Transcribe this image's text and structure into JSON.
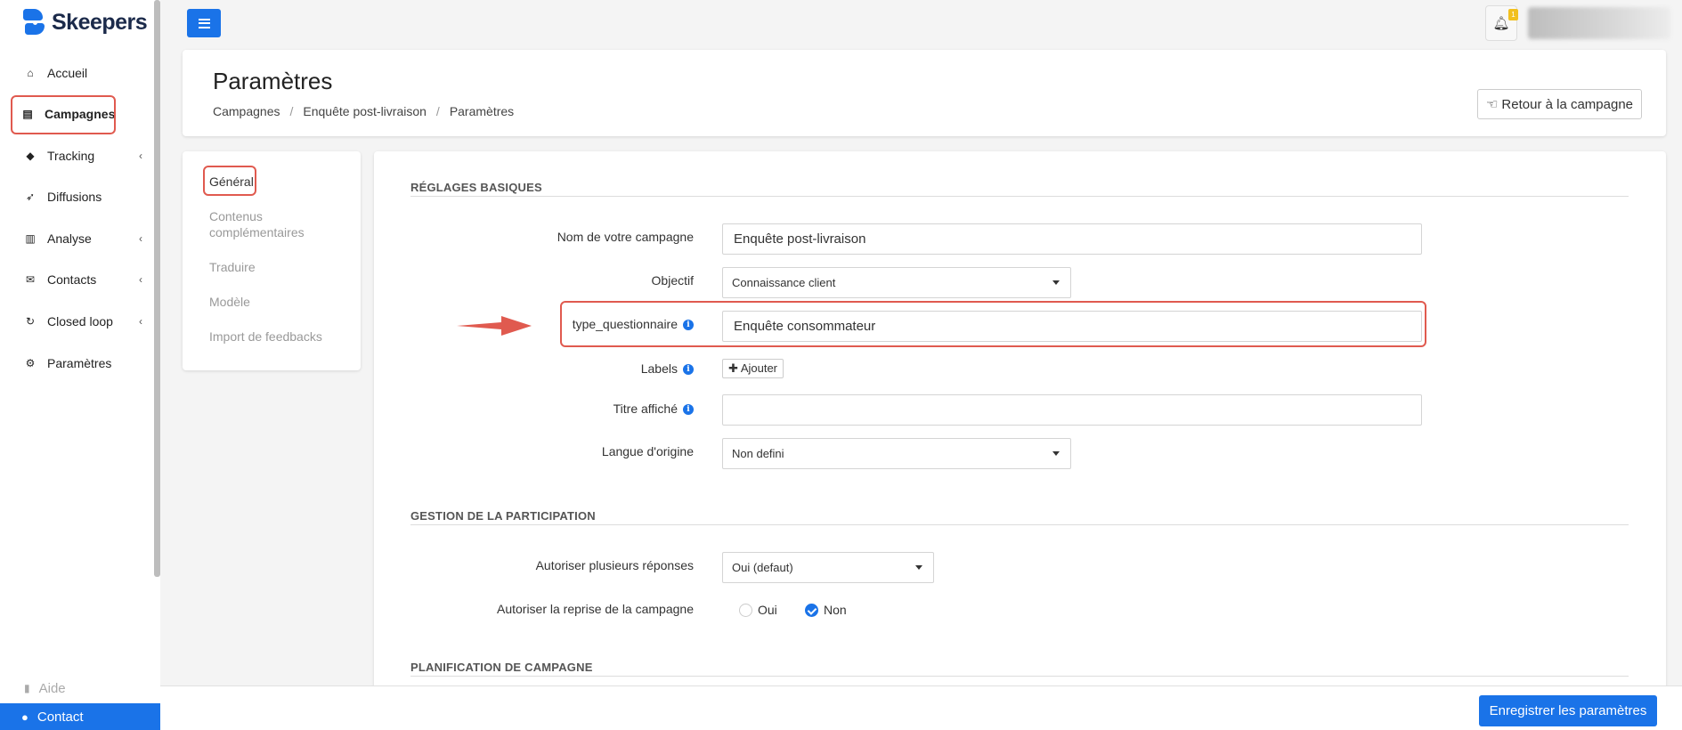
{
  "brand": {
    "name": "Skeepers",
    "accent": "#1a73e8",
    "highlight": "#e05a4f"
  },
  "sidebar": {
    "items": [
      {
        "label": "Accueil",
        "icon": "home-icon"
      },
      {
        "label": "Campagnes",
        "icon": "document-icon",
        "active": true
      },
      {
        "label": "Tracking",
        "icon": "tag-icon",
        "has_children": true
      },
      {
        "label": "Diffusions",
        "icon": "rocket-icon"
      },
      {
        "label": "Analyse",
        "icon": "bar-chart-icon",
        "has_children": true
      },
      {
        "label": "Contacts",
        "icon": "envelope-icon",
        "has_children": true
      },
      {
        "label": "Closed loop",
        "icon": "refresh-icon",
        "has_children": true
      },
      {
        "label": "Paramètres",
        "icon": "gear-icon"
      }
    ],
    "help_label": "Aide",
    "contact_label": "Contact"
  },
  "topbar": {
    "notification_count": "1"
  },
  "header": {
    "title": "Paramètres",
    "breadcrumb": [
      "Campagnes",
      "Enquête post-livraison",
      "Paramètres"
    ],
    "return_button": "Retour à la campagne"
  },
  "tabs": [
    {
      "label": "Général",
      "active": true
    },
    {
      "label": "Contenus complémentaires"
    },
    {
      "label": "Traduire"
    },
    {
      "label": "Modèle"
    },
    {
      "label": "Import de feedbacks"
    }
  ],
  "sections": {
    "basic": "RÉGLAGES BASIQUES",
    "participation": "GESTION DE LA PARTICIPATION",
    "planning": "PLANIFICATION DE CAMPAGNE"
  },
  "fields": {
    "campaign_name": {
      "label": "Nom de votre campagne",
      "value": "Enquête post-livraison"
    },
    "objective": {
      "label": "Objectif",
      "value": "Connaissance client"
    },
    "type_questionnaire": {
      "label": "type_questionnaire",
      "value": "Enquête consommateur"
    },
    "labels": {
      "label": "Labels",
      "button": "Ajouter"
    },
    "displayed_title": {
      "label": "Titre affiché",
      "value": ""
    },
    "origin_language": {
      "label": "Langue d'origine",
      "value": "Non defini"
    },
    "multiple_answers": {
      "label": "Autoriser plusieurs réponses",
      "value": "Oui (defaut)"
    },
    "resume_campaign": {
      "label": "Autoriser la reprise de la campagne",
      "options": [
        "Oui",
        "Non"
      ],
      "selected": "Non"
    }
  },
  "footer": {
    "save_button": "Enregistrer les paramètres"
  }
}
